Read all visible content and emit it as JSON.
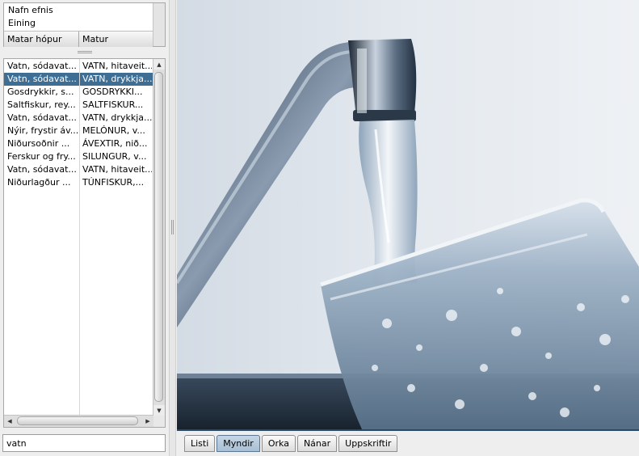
{
  "details": {
    "rows": [
      "Nafn efnis",
      "Eining"
    ],
    "columns": [
      "Matar hópur",
      "Matur"
    ]
  },
  "table": {
    "rows": [
      {
        "c1": "Vatn, sódavat...",
        "c2": "VATN, hitaveit...",
        "selected": false
      },
      {
        "c1": "Vatn, sódavat...",
        "c2": "VATN, drykkja...",
        "selected": true
      },
      {
        "c1": "Gosdrykkir, s...",
        "c2": "GOSDRYKKI...",
        "selected": false
      },
      {
        "c1": "Saltfiskur, rey...",
        "c2": "SALTFISKUR...",
        "selected": false
      },
      {
        "c1": "Vatn, sódavat...",
        "c2": "VATN, drykkja...",
        "selected": false
      },
      {
        "c1": "Nýir, frystir áv...",
        "c2": "MELÓNUR, v...",
        "selected": false
      },
      {
        "c1": "Niðursoðnir ...",
        "c2": "ÁVEXTIR, nið...",
        "selected": false
      },
      {
        "c1": "Ferskur og fry...",
        "c2": "SILUNGUR, v...",
        "selected": false
      },
      {
        "c1": "Vatn, sódavat...",
        "c2": "VATN, hitaveit...",
        "selected": false
      },
      {
        "c1": "Niðurlagður ...",
        "c2": "TÚNFISKUR,...",
        "selected": false
      }
    ]
  },
  "search": {
    "value": "vatn"
  },
  "tabs": [
    {
      "label": "Listi",
      "active": false
    },
    {
      "label": "Myndir",
      "active": true
    },
    {
      "label": "Orka",
      "active": false
    },
    {
      "label": "Nánar",
      "active": false
    },
    {
      "label": "Uppskriftir",
      "active": false
    }
  ],
  "icons": {
    "scroll_up": "arrow-up-icon",
    "scroll_down": "arrow-down-icon",
    "scroll_left": "arrow-left-icon",
    "scroll_right": "arrow-right-icon"
  },
  "colors": {
    "selection": "#3f6e94",
    "tab_active": "#a9bfd4"
  }
}
